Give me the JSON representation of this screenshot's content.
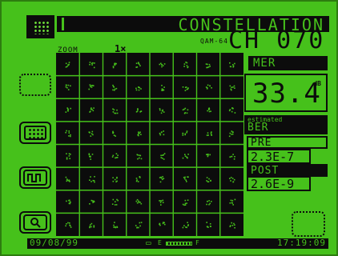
{
  "header": {
    "title": "CONSTELLATION",
    "channel": "CH 070",
    "modulation": "QAM-64",
    "zoom_label": "ZOOM",
    "zoom_value": "1×"
  },
  "measurements": {
    "mer_label": "MER",
    "mer_value": "33.4",
    "mer_unit": "dB",
    "ber_caption": "estimated",
    "ber_label": "BER",
    "pre_label": "PRE",
    "pre_value": "2.3E-7",
    "post_label": "POST",
    "post_value": "2.6E-9"
  },
  "footer": {
    "date": "09/08/99",
    "time": "17:19:09",
    "battery_empty": "E",
    "battery_full": "F"
  },
  "icons": [
    "grid-icon",
    "constellation-icon",
    "spectrum-icon",
    "zoom-icon",
    "battery-icon"
  ],
  "colors": {
    "background": "#46c11b",
    "foreground": "#0c0c0c"
  }
}
